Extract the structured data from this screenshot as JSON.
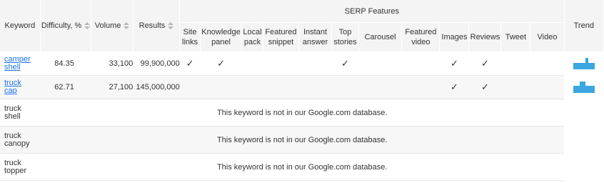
{
  "header": {
    "keyword": "Keyword",
    "difficulty": "Difficulty, %",
    "volume": "Volume",
    "results": "Results",
    "serp_features": "SERP Features",
    "trend": "Trend",
    "features": [
      [
        "Site",
        "links"
      ],
      [
        "Knowledge",
        "panel"
      ],
      [
        "Local",
        "pack"
      ],
      [
        "Featured",
        "snippet"
      ],
      [
        "Instant",
        "answer"
      ],
      [
        "Top",
        "stories"
      ],
      [
        "Carousel",
        ""
      ],
      [
        "Featured",
        "video"
      ],
      [
        "Images",
        ""
      ],
      [
        "Reviews",
        ""
      ],
      [
        "Tweet",
        ""
      ],
      [
        "Video",
        ""
      ]
    ]
  },
  "rows": [
    {
      "keyword": [
        "camper",
        "shell"
      ],
      "difficulty": "84.35",
      "volume": "33,100",
      "results": "99,900,000",
      "checks": [
        "✓",
        "✓",
        "",
        "",
        "",
        "✓",
        "",
        "",
        "✓",
        "✓",
        "",
        ""
      ],
      "trend_levels": [
        0.6,
        0.6,
        0.6,
        0.6,
        1.0,
        0.6,
        0.6
      ]
    },
    {
      "keyword": [
        "truck",
        "cap"
      ],
      "difficulty": "62.71",
      "volume": "27,100",
      "results": "145,000,000",
      "checks": [
        "",
        "",
        "",
        "",
        "",
        "",
        "",
        "",
        "✓",
        "✓",
        "",
        ""
      ],
      "trend_levels": [
        0.6,
        0.6,
        1.0,
        1.0,
        0.6,
        0.6,
        0.6
      ]
    }
  ],
  "missing_rows": [
    {
      "keyword": [
        "truck",
        "shell"
      ],
      "message": "This keyword is not in our Google.com database."
    },
    {
      "keyword": [
        "truck",
        "canopy"
      ],
      "message": "This keyword is not in our Google.com database."
    },
    {
      "keyword": [
        "truck",
        "topper"
      ],
      "message": "This keyword is not in our Google.com database."
    }
  ],
  "colors": {
    "link": "#1a73e8",
    "trend_bar": "#3ba6e0",
    "header_bg": "#f4f4f4"
  }
}
